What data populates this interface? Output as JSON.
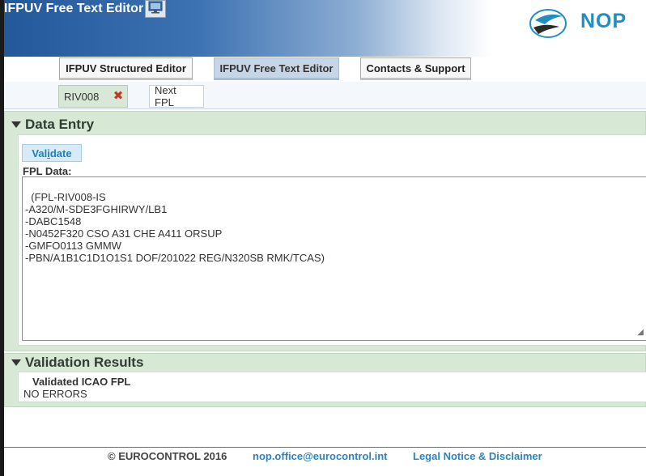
{
  "header": {
    "app_title": "IFPUV Free Text Editor",
    "logo_text": "NOP",
    "monitor_icon": "monitor-icon"
  },
  "tabs": [
    {
      "label": "IFPUV Structured Editor",
      "active": false
    },
    {
      "label": "IFPUV Free Text Editor",
      "active": true
    },
    {
      "label": "Contacts & Support",
      "active": false
    }
  ],
  "doc_tabs": {
    "riv": {
      "label": "RIV008",
      "close_icon": "close-icon"
    },
    "next": {
      "label": "Next FPL"
    }
  },
  "data_entry": {
    "title": "Data Entry",
    "validate_label_pre": "Val",
    "validate_label_u": "i",
    "validate_label_post": "date",
    "fpl_label": "FPL Data:",
    "fpl_text": "(FPL-RIV008-IS\n-A320/M-SDE3FGHIRWY/LB1\n-DABC1548\n-N0452F320 CSO A31 CHE A411 ORSUP\n-GMFO0113 GMMW\n-PBN/A1B1C1D1O1S1 DOF/201022 REG/N320SB RMK/TCAS)"
  },
  "validation": {
    "title": "Validation Results",
    "label": "Validated ICAO FPL",
    "value": "NO ERRORS"
  },
  "footer": {
    "copyright": "© EUROCONTROL 2016",
    "email": "nop.office@eurocontrol.int",
    "legal": "Legal Notice & Disclaimer"
  },
  "colors": {
    "header_blue": "#23599b",
    "panel_green": "#d7e8d5",
    "link_blue": "#2a85c2",
    "nop_blue": "#1f8fc2"
  }
}
